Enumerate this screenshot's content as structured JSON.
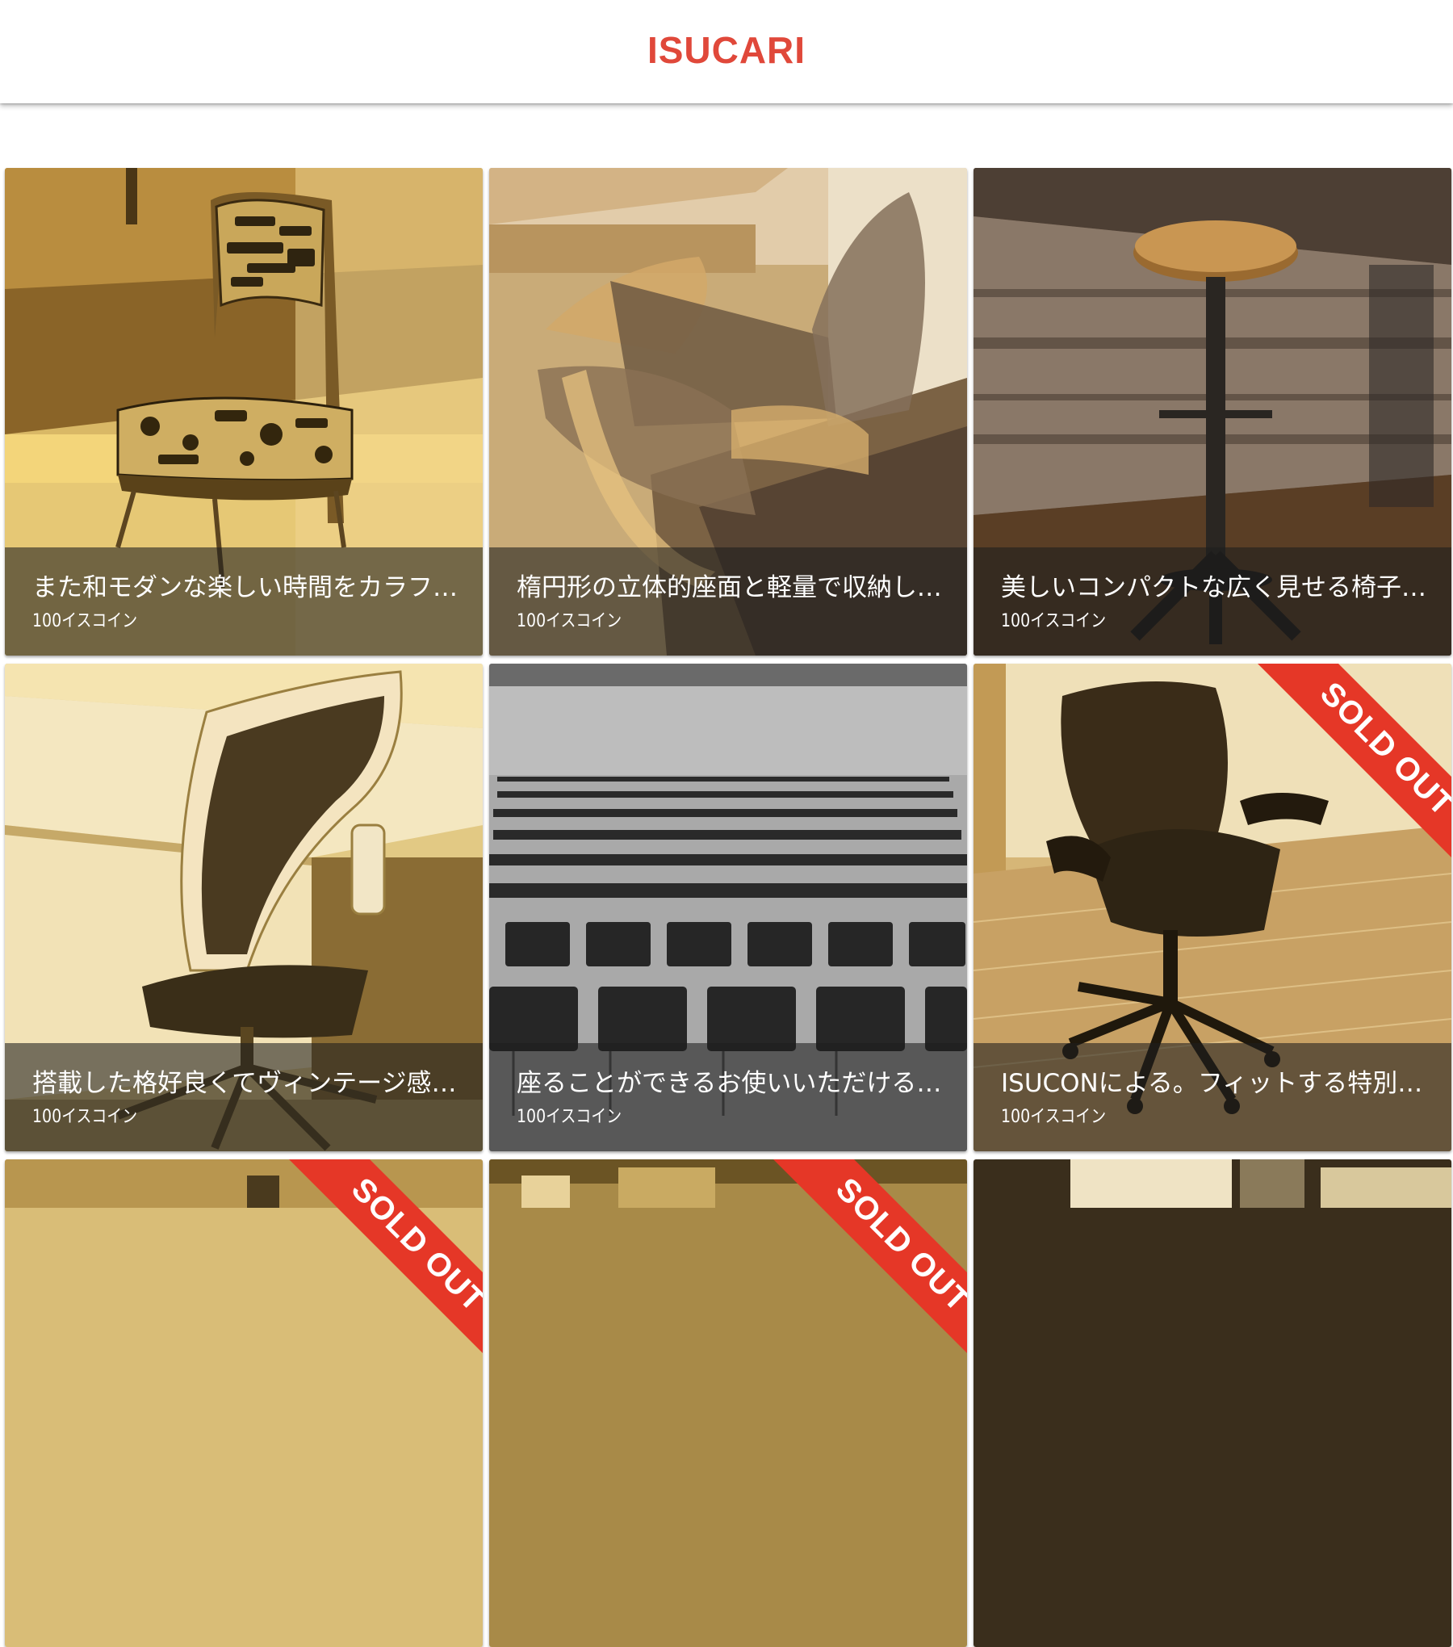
{
  "header": {
    "title": "ISUCARI"
  },
  "items": [
    {
      "name": "また和モダンな楽しい時間をカラフルに彩ります",
      "price": "100イスコイン",
      "sold_out": false
    },
    {
      "name": "楕円形の立体的座面と軽量で収納しやすい",
      "price": "100イスコイン",
      "sold_out": false
    },
    {
      "name": "美しいコンパクトな広く見せる椅子です",
      "price": "100イスコイン",
      "sold_out": false
    },
    {
      "name": "搭載した格好良くてヴィンテージ感のある",
      "price": "100イスコイン",
      "sold_out": false
    },
    {
      "name": "座ることができるお使いいただける椅子",
      "price": "100イスコイン",
      "sold_out": false
    },
    {
      "name": "ISUCONによる。フィットする特別な椅子",
      "price": "100イスコイン",
      "sold_out": true
    },
    {
      "name": "",
      "price": "",
      "sold_out": true
    },
    {
      "name": "",
      "price": "",
      "sold_out": true
    },
    {
      "name": "",
      "price": "",
      "sold_out": false
    }
  ],
  "sold_out_label": "SOLD OUT",
  "colors": {
    "brand": "#e0483a",
    "sold_ribbon": "#e53727"
  }
}
